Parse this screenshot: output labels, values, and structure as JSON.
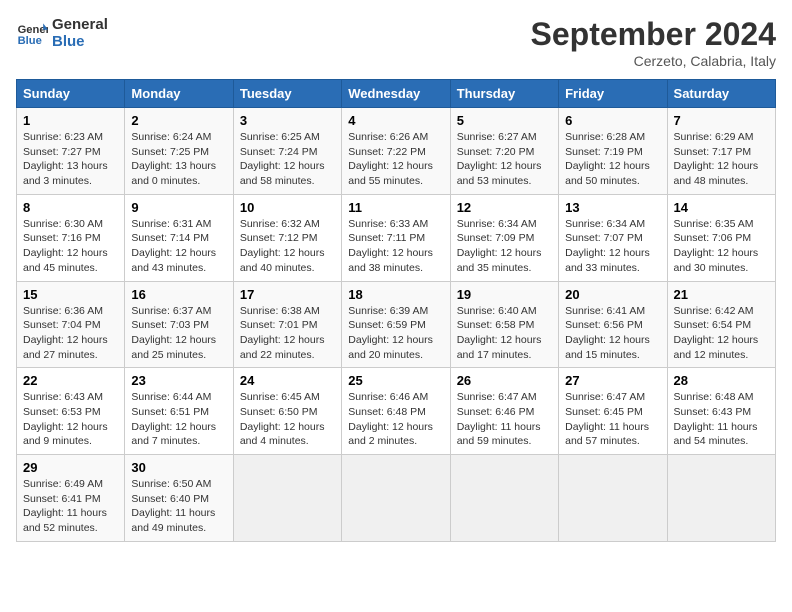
{
  "header": {
    "logo_general": "General",
    "logo_blue": "Blue",
    "month_title": "September 2024",
    "location": "Cerzeto, Calabria, Italy"
  },
  "columns": [
    "Sunday",
    "Monday",
    "Tuesday",
    "Wednesday",
    "Thursday",
    "Friday",
    "Saturday"
  ],
  "weeks": [
    [
      {
        "day": "1",
        "sunrise": "Sunrise: 6:23 AM",
        "sunset": "Sunset: 7:27 PM",
        "daylight": "Daylight: 13 hours and 3 minutes."
      },
      {
        "day": "2",
        "sunrise": "Sunrise: 6:24 AM",
        "sunset": "Sunset: 7:25 PM",
        "daylight": "Daylight: 13 hours and 0 minutes."
      },
      {
        "day": "3",
        "sunrise": "Sunrise: 6:25 AM",
        "sunset": "Sunset: 7:24 PM",
        "daylight": "Daylight: 12 hours and 58 minutes."
      },
      {
        "day": "4",
        "sunrise": "Sunrise: 6:26 AM",
        "sunset": "Sunset: 7:22 PM",
        "daylight": "Daylight: 12 hours and 55 minutes."
      },
      {
        "day": "5",
        "sunrise": "Sunrise: 6:27 AM",
        "sunset": "Sunset: 7:20 PM",
        "daylight": "Daylight: 12 hours and 53 minutes."
      },
      {
        "day": "6",
        "sunrise": "Sunrise: 6:28 AM",
        "sunset": "Sunset: 7:19 PM",
        "daylight": "Daylight: 12 hours and 50 minutes."
      },
      {
        "day": "7",
        "sunrise": "Sunrise: 6:29 AM",
        "sunset": "Sunset: 7:17 PM",
        "daylight": "Daylight: 12 hours and 48 minutes."
      }
    ],
    [
      {
        "day": "8",
        "sunrise": "Sunrise: 6:30 AM",
        "sunset": "Sunset: 7:16 PM",
        "daylight": "Daylight: 12 hours and 45 minutes."
      },
      {
        "day": "9",
        "sunrise": "Sunrise: 6:31 AM",
        "sunset": "Sunset: 7:14 PM",
        "daylight": "Daylight: 12 hours and 43 minutes."
      },
      {
        "day": "10",
        "sunrise": "Sunrise: 6:32 AM",
        "sunset": "Sunset: 7:12 PM",
        "daylight": "Daylight: 12 hours and 40 minutes."
      },
      {
        "day": "11",
        "sunrise": "Sunrise: 6:33 AM",
        "sunset": "Sunset: 7:11 PM",
        "daylight": "Daylight: 12 hours and 38 minutes."
      },
      {
        "day": "12",
        "sunrise": "Sunrise: 6:34 AM",
        "sunset": "Sunset: 7:09 PM",
        "daylight": "Daylight: 12 hours and 35 minutes."
      },
      {
        "day": "13",
        "sunrise": "Sunrise: 6:34 AM",
        "sunset": "Sunset: 7:07 PM",
        "daylight": "Daylight: 12 hours and 33 minutes."
      },
      {
        "day": "14",
        "sunrise": "Sunrise: 6:35 AM",
        "sunset": "Sunset: 7:06 PM",
        "daylight": "Daylight: 12 hours and 30 minutes."
      }
    ],
    [
      {
        "day": "15",
        "sunrise": "Sunrise: 6:36 AM",
        "sunset": "Sunset: 7:04 PM",
        "daylight": "Daylight: 12 hours and 27 minutes."
      },
      {
        "day": "16",
        "sunrise": "Sunrise: 6:37 AM",
        "sunset": "Sunset: 7:03 PM",
        "daylight": "Daylight: 12 hours and 25 minutes."
      },
      {
        "day": "17",
        "sunrise": "Sunrise: 6:38 AM",
        "sunset": "Sunset: 7:01 PM",
        "daylight": "Daylight: 12 hours and 22 minutes."
      },
      {
        "day": "18",
        "sunrise": "Sunrise: 6:39 AM",
        "sunset": "Sunset: 6:59 PM",
        "daylight": "Daylight: 12 hours and 20 minutes."
      },
      {
        "day": "19",
        "sunrise": "Sunrise: 6:40 AM",
        "sunset": "Sunset: 6:58 PM",
        "daylight": "Daylight: 12 hours and 17 minutes."
      },
      {
        "day": "20",
        "sunrise": "Sunrise: 6:41 AM",
        "sunset": "Sunset: 6:56 PM",
        "daylight": "Daylight: 12 hours and 15 minutes."
      },
      {
        "day": "21",
        "sunrise": "Sunrise: 6:42 AM",
        "sunset": "Sunset: 6:54 PM",
        "daylight": "Daylight: 12 hours and 12 minutes."
      }
    ],
    [
      {
        "day": "22",
        "sunrise": "Sunrise: 6:43 AM",
        "sunset": "Sunset: 6:53 PM",
        "daylight": "Daylight: 12 hours and 9 minutes."
      },
      {
        "day": "23",
        "sunrise": "Sunrise: 6:44 AM",
        "sunset": "Sunset: 6:51 PM",
        "daylight": "Daylight: 12 hours and 7 minutes."
      },
      {
        "day": "24",
        "sunrise": "Sunrise: 6:45 AM",
        "sunset": "Sunset: 6:50 PM",
        "daylight": "Daylight: 12 hours and 4 minutes."
      },
      {
        "day": "25",
        "sunrise": "Sunrise: 6:46 AM",
        "sunset": "Sunset: 6:48 PM",
        "daylight": "Daylight: 12 hours and 2 minutes."
      },
      {
        "day": "26",
        "sunrise": "Sunrise: 6:47 AM",
        "sunset": "Sunset: 6:46 PM",
        "daylight": "Daylight: 11 hours and 59 minutes."
      },
      {
        "day": "27",
        "sunrise": "Sunrise: 6:47 AM",
        "sunset": "Sunset: 6:45 PM",
        "daylight": "Daylight: 11 hours and 57 minutes."
      },
      {
        "day": "28",
        "sunrise": "Sunrise: 6:48 AM",
        "sunset": "Sunset: 6:43 PM",
        "daylight": "Daylight: 11 hours and 54 minutes."
      }
    ],
    [
      {
        "day": "29",
        "sunrise": "Sunrise: 6:49 AM",
        "sunset": "Sunset: 6:41 PM",
        "daylight": "Daylight: 11 hours and 52 minutes."
      },
      {
        "day": "30",
        "sunrise": "Sunrise: 6:50 AM",
        "sunset": "Sunset: 6:40 PM",
        "daylight": "Daylight: 11 hours and 49 minutes."
      },
      null,
      null,
      null,
      null,
      null
    ]
  ]
}
